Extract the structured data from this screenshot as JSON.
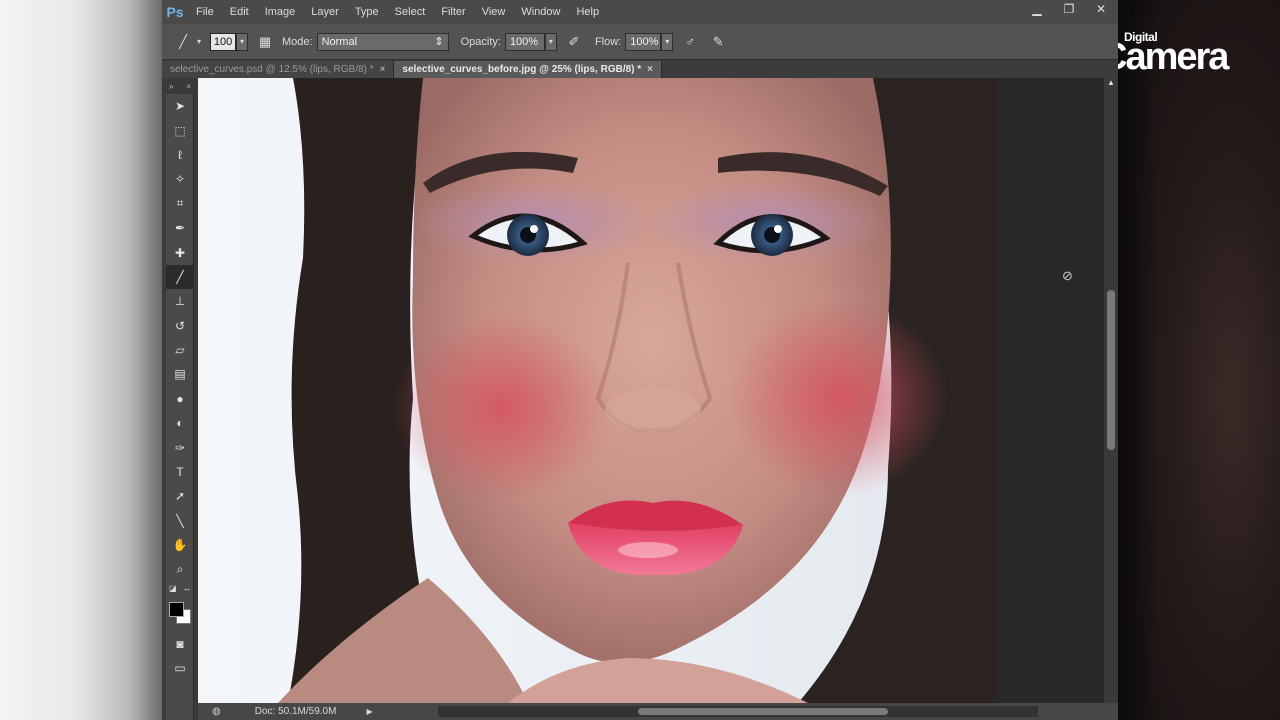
{
  "watermark": {
    "small": "Digital",
    "big": "Camera"
  },
  "menubar": {
    "logo": "Ps",
    "items": [
      "File",
      "Edit",
      "Image",
      "Layer",
      "Type",
      "Select",
      "Filter",
      "View",
      "Window",
      "Help"
    ]
  },
  "options": {
    "brush_size": "100",
    "mode_label": "Mode:",
    "mode_value": "Normal",
    "opacity_label": "Opacity:",
    "opacity_value": "100%",
    "flow_label": "Flow:",
    "flow_value": "100%"
  },
  "tabs": [
    {
      "label": "selective_curves.psd @ 12.5% (lips, RGB/8) *",
      "close": "×"
    },
    {
      "label": "selective_curves_before.jpg @ 25% (lips, RGB/8) *",
      "close": "×"
    }
  ],
  "status": {
    "doc": "Doc: 50.1M/59.0M"
  }
}
